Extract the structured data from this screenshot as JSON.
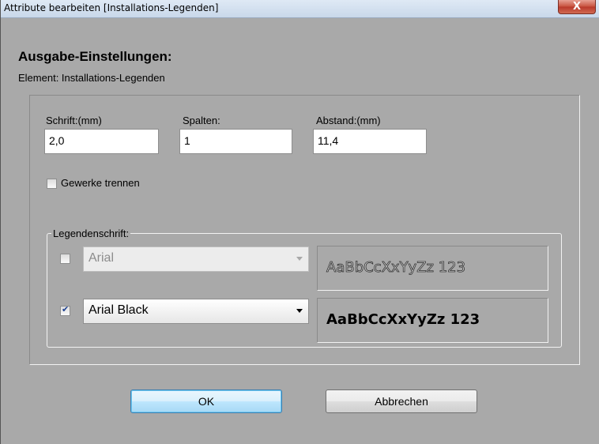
{
  "window": {
    "title": "Attribute bearbeiten [Installations-Legenden]",
    "close_label": "X"
  },
  "heading": "Ausgabe-Einstellungen:",
  "element_line": "Element: Installations-Legenden",
  "fields": {
    "schrift": {
      "label": "Schrift:(mm)",
      "value": "2,0"
    },
    "spalten": {
      "label": "Spalten:",
      "value": "1"
    },
    "abstand": {
      "label": "Abstand:(mm)",
      "value": "11,4"
    }
  },
  "gewerke_trennen": {
    "label": "Gewerke trennen",
    "checked": false
  },
  "legendenschrift": {
    "label": "Legendenschrift:",
    "rows": [
      {
        "checked": false,
        "enabled": false,
        "font": "Arial",
        "preview": "AaBbCcXxYyZz 123"
      },
      {
        "checked": true,
        "enabled": true,
        "font": "Arial Black",
        "preview": "AaBbCcXxYyZz 123"
      }
    ]
  },
  "buttons": {
    "ok": "OK",
    "cancel": "Abbrechen"
  },
  "colors": {
    "dialog_bg": "#a9a9a9",
    "ok_button_accent": "#a7d9f5",
    "close_button": "#c7513d"
  },
  "icons": {
    "close": "close-icon",
    "dropdown": "chevron-down-icon",
    "check": "checkmark-icon"
  }
}
